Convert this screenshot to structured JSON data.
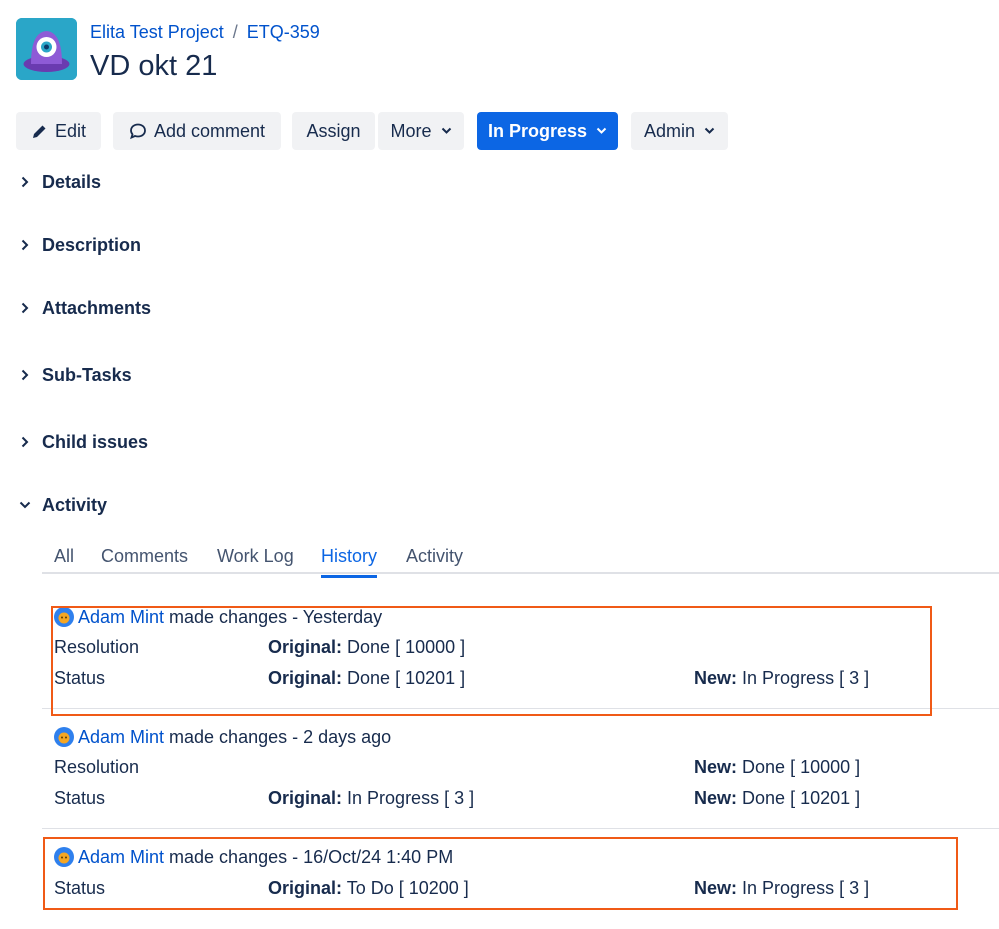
{
  "header": {
    "breadcrumb": {
      "project": "Elita Test Project",
      "separator": "/",
      "issue_key": "ETQ-359"
    },
    "title": "VD okt 21"
  },
  "toolbar": {
    "edit": "Edit",
    "add_comment": "Add comment",
    "assign": "Assign",
    "more": "More",
    "status": "In Progress",
    "admin": "Admin"
  },
  "sections": {
    "details": "Details",
    "description": "Description",
    "attachments": "Attachments",
    "subtasks": "Sub-Tasks",
    "child_issues": "Child issues",
    "activity": "Activity"
  },
  "activity_tabs": [
    "All",
    "Comments",
    "Work Log",
    "History",
    "Activity"
  ],
  "active_tab": "History",
  "history": [
    {
      "user": "Adam Mint",
      "action": "made changes - Yesterday",
      "rows": [
        {
          "field": "Resolution",
          "original_label": "Original:",
          "original": "Done [ 10000 ]",
          "new_label": "",
          "new": ""
        },
        {
          "field": "Status",
          "original_label": "Original:",
          "original": "Done [ 10201 ]",
          "new_label": "New:",
          "new": "In Progress [ 3 ]"
        }
      ]
    },
    {
      "user": "Adam Mint",
      "action": "made changes - 2 days ago",
      "rows": [
        {
          "field": "Resolution",
          "original_label": "",
          "original": "",
          "new_label": "New:",
          "new": "Done [ 10000 ]"
        },
        {
          "field": "Status",
          "original_label": "Original:",
          "original": "In Progress [ 3 ]",
          "new_label": "New:",
          "new": "Done [ 10201 ]"
        }
      ]
    },
    {
      "user": "Adam Mint",
      "action": "made changes - 16/Oct/24 1:40 PM",
      "rows": [
        {
          "field": "Status",
          "original_label": "Original:",
          "original": "To Do [ 10200 ]",
          "new_label": "New:",
          "new": "In Progress [ 3 ]"
        }
      ]
    }
  ],
  "colors": {
    "link": "#0052cc",
    "primary_button": "#0c66e4",
    "highlight_box": "#f05a16",
    "button_bg": "#f1f2f4"
  }
}
